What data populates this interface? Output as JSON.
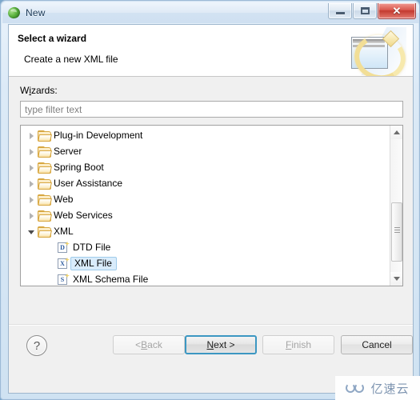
{
  "window": {
    "title": "New",
    "icon": "eclipse-new-icon",
    "controls": {
      "minimize": "–",
      "maximize": "□",
      "close": "✕"
    }
  },
  "banner": {
    "title": "Select a wizard",
    "subtitle": "Create a new XML file",
    "icon": "wizard-banner-icon"
  },
  "form": {
    "wizards_label_prefix": "W",
    "wizards_label_mnemonic": "i",
    "wizards_label_suffix": "zards:",
    "filter_placeholder": "type filter text",
    "filter_value": ""
  },
  "tree": {
    "items": [
      {
        "label": "Plug-in Development",
        "level": 0,
        "state": "collapsed",
        "icon": "folder-icon",
        "selected": false
      },
      {
        "label": "Server",
        "level": 0,
        "state": "collapsed",
        "icon": "folder-icon",
        "selected": false
      },
      {
        "label": "Spring Boot",
        "level": 0,
        "state": "collapsed",
        "icon": "folder-icon",
        "selected": false
      },
      {
        "label": "User Assistance",
        "level": 0,
        "state": "collapsed",
        "icon": "folder-icon",
        "selected": false
      },
      {
        "label": "Web",
        "level": 0,
        "state": "collapsed",
        "icon": "folder-icon",
        "selected": false
      },
      {
        "label": "Web Services",
        "level": 0,
        "state": "collapsed",
        "icon": "folder-icon",
        "selected": false
      },
      {
        "label": "XML",
        "level": 0,
        "state": "expanded",
        "icon": "folder-icon",
        "selected": false
      },
      {
        "label": "DTD File",
        "level": 1,
        "state": "leaf",
        "icon": "dtd-file-icon",
        "letter": "D",
        "selected": false
      },
      {
        "label": "XML File",
        "level": 1,
        "state": "leaf",
        "icon": "xml-file-icon",
        "letter": "X",
        "selected": true
      },
      {
        "label": "XML Schema File",
        "level": 1,
        "state": "leaf",
        "icon": "xml-schema-file-icon",
        "letter": "S",
        "selected": false
      }
    ],
    "scrollbar": {
      "up_arrow": "▲",
      "down_arrow": "▼",
      "thumb_top_pct": 48,
      "thumb_height_pct": 37
    }
  },
  "buttons": {
    "help": "?",
    "back": {
      "prefix": "< ",
      "mnemonic": "B",
      "suffix": "ack",
      "enabled": false
    },
    "next": {
      "prefix": "",
      "mnemonic": "N",
      "suffix": "ext >",
      "enabled": true,
      "is_default": true
    },
    "finish": {
      "prefix": "",
      "mnemonic": "F",
      "suffix": "inish",
      "enabled": false
    },
    "cancel": {
      "label": "Cancel",
      "enabled": true
    }
  },
  "watermark": {
    "text": "亿速云",
    "logo": "yisuyun-logo-icon"
  },
  "colors": {
    "selection_fill": "#d9ecfb",
    "selection_border": "#9fcbea",
    "default_button_border": "#3c97c2",
    "dialog_background": "#f0f0f0",
    "banner_background": "#ffffff",
    "close_button": "#c3392f"
  }
}
